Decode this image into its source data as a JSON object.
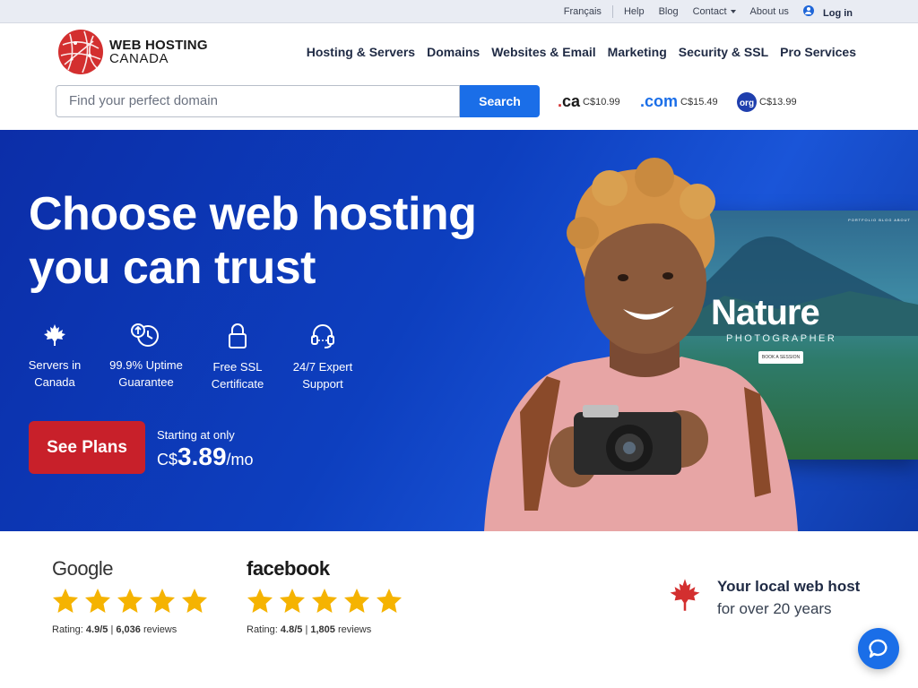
{
  "topbar": {
    "language": "Français",
    "help": "Help",
    "blog": "Blog",
    "contact": "Contact",
    "about": "About us",
    "login": "Log in"
  },
  "logo": {
    "line1": "WEB HOSTING",
    "line2": "CANADA"
  },
  "nav": {
    "items": [
      "Hosting & Servers",
      "Domains",
      "Websites & Email",
      "Marketing",
      "Security & SSL",
      "Pro Services"
    ]
  },
  "search": {
    "placeholder": "Find your perfect domain",
    "button": "Search"
  },
  "tlds": [
    {
      "name": "ca",
      "price": "C$10.99"
    },
    {
      "name": "com",
      "price": "C$15.49"
    },
    {
      "name": "org",
      "price": "C$13.99"
    }
  ],
  "hero": {
    "headline_1": "Choose web hosting",
    "headline_2": "you can trust",
    "features": [
      {
        "icon": "maple-leaf-icon",
        "line1": "Servers in",
        "line2": "Canada"
      },
      {
        "icon": "uptime-clock-icon",
        "line1": "99.9% Uptime",
        "line2": "Guarantee"
      },
      {
        "icon": "lock-icon",
        "line1": "Free SSL",
        "line2": "Certificate"
      },
      {
        "icon": "headset-icon",
        "line1": "24/7 Expert",
        "line2": "Support"
      }
    ],
    "cta": "See Plans",
    "price_label": "Starting at only",
    "price_currency": "C$",
    "price_value": "3.89",
    "price_unit": "/mo"
  },
  "mockup": {
    "title": "Nature",
    "subtitle": "PHOTOGRAPHER",
    "button": "BOOK A SESSION",
    "nav": "PORTFOLIO  BLOG  ABOUT"
  },
  "reviews": [
    {
      "brand": "Google",
      "rating_label": "Rating:",
      "rating": "4.9/5",
      "count": "6,036",
      "count_label": "reviews",
      "stars": 5
    },
    {
      "brand": "facebook",
      "rating_label": "Rating:",
      "rating": "4.8/5",
      "count": "1,805",
      "count_label": "reviews",
      "stars": 5
    }
  ],
  "local": {
    "line1": "Your local web host",
    "line2": "for over 20 years"
  },
  "colors": {
    "brand_red": "#c8202a",
    "brand_blue": "#1a6ee8",
    "hero_bg": "#0d3fbf",
    "star": "#f5b301"
  }
}
